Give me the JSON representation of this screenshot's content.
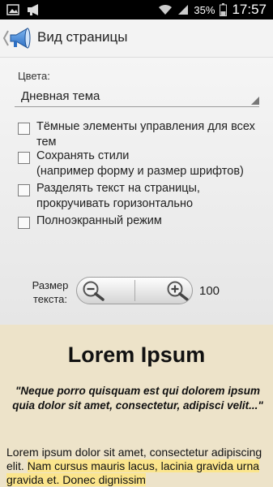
{
  "status_bar": {
    "battery": "35%",
    "time": "17:57"
  },
  "action_bar": {
    "title": "Вид страницы"
  },
  "settings": {
    "colors_label": "Цвета:",
    "theme_value": "Дневная тема",
    "options": [
      {
        "label": "Тёмные элементы управления для всех\nтем",
        "checked": false
      },
      {
        "label": "Сохранять стили\n(например форму и размер шрифтов)",
        "checked": false
      },
      {
        "label": "Разделять текст на страницы,\nпрокручивать горизонтально",
        "checked": false
      },
      {
        "label": "Полноэкранный режим",
        "checked": false
      }
    ],
    "text_size_label": "Размер\nтекста:",
    "text_size_value": "100"
  },
  "preview": {
    "title": "Lorem Ipsum",
    "quote": "\"Neque porro quisquam est qui dolorem ipsum quia dolor sit amet, consectetur, adipisci velit...\"",
    "body_plain": "Lorem ipsum dolor sit amet, consectetur adipiscing elit. ",
    "body_highlight": "Nam cursus mauris lacus, lacinia gravida urna gravida et. Donec dignissim",
    "highlight_color": "#fbe58c",
    "background_color": "#ede3c9"
  }
}
